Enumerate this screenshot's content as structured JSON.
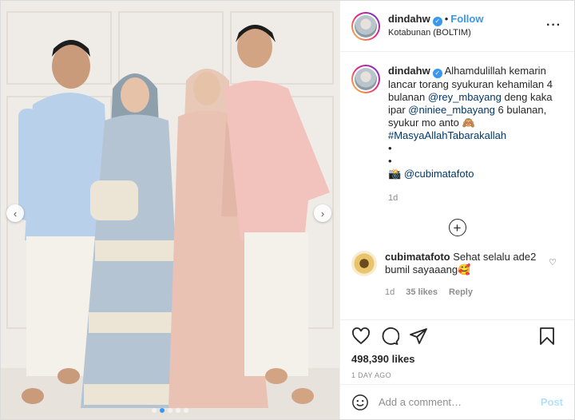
{
  "post": {
    "username": "dindahw",
    "follow_label": "Follow",
    "location": "Kotabunan (BOLTIM)",
    "more_label": "···",
    "verified_mark": "✓"
  },
  "caption": {
    "username": "dindahw",
    "text_1": "Alhamdulillah kemarin lancar torang syukuran kehamilan 4 bulanan ",
    "mention_1": "@rey_mbayang",
    "text_2": " deng kaka ipar ",
    "mention_2": "@niniee_mbayang",
    "text_3": " 6 bulanan, syukur mo anto 🙈",
    "hashtag": "#MasyaAllahTabarakallah",
    "bullet_1": "•",
    "bullet_2": "•",
    "camera_emoji": "📸",
    "credit": "@cubimatafoto",
    "age": "1d"
  },
  "comment": {
    "username": "cubimatafoto",
    "text": "Sehat selalu ade2 bumil sayaaang🥰",
    "age": "1d",
    "likes": "35 likes",
    "reply": "Reply"
  },
  "stats": {
    "likes": "498,390 likes",
    "time": "1 DAY AGO"
  },
  "composer": {
    "placeholder": "Add a comment…",
    "post_label": "Post"
  },
  "carousel": {
    "prev": "‹",
    "next": "›",
    "dots": 5,
    "active_dot": 1
  },
  "colors": {
    "accent": "#3897f0",
    "link": "#00376b",
    "muted": "#8e8e8e"
  }
}
